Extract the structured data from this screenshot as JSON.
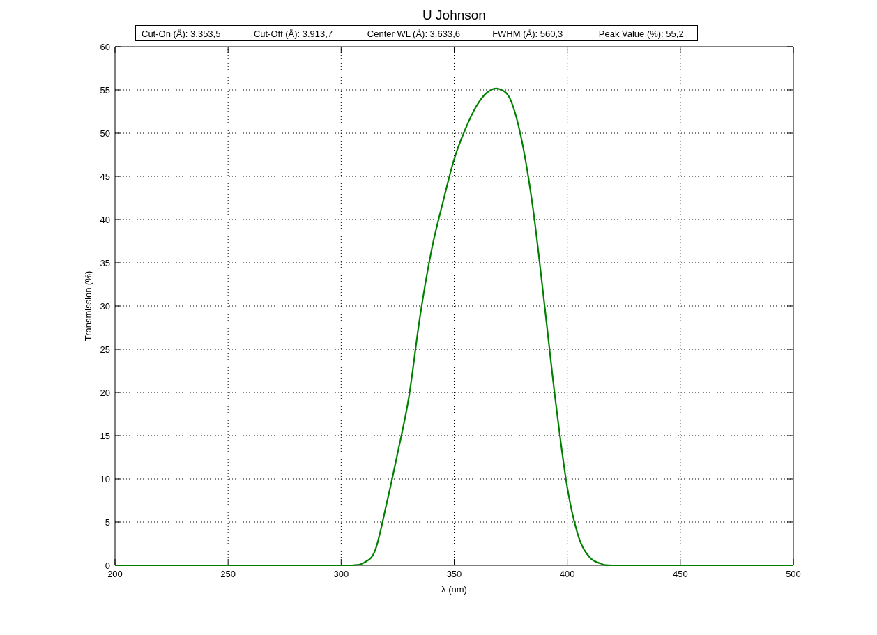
{
  "chart_data": {
    "type": "line",
    "title": "U Johnson",
    "xlabel": "λ (nm)",
    "ylabel": "Transmission (%)",
    "grid": true,
    "xlim": [
      200,
      500
    ],
    "ylim": [
      0,
      60
    ],
    "xticks": [
      200,
      250,
      300,
      350,
      400,
      450,
      500
    ],
    "yticks": [
      0,
      5,
      10,
      15,
      20,
      25,
      30,
      35,
      40,
      45,
      50,
      55,
      60
    ],
    "x": [
      200,
      250,
      300,
      305,
      310,
      315,
      320,
      325,
      330,
      335,
      340,
      345,
      350,
      355,
      360,
      365,
      370,
      375,
      380,
      385,
      390,
      395,
      400,
      405,
      410,
      415,
      420,
      450,
      500
    ],
    "series": [
      {
        "color": "#008000",
        "values": [
          0,
          0,
          0,
          0,
          0.3,
          1.7,
          7,
          13,
          19.5,
          29,
          36.5,
          42,
          47,
          50.5,
          53.2,
          54.8,
          55.1,
          53.8,
          49,
          41,
          30,
          18.6,
          9,
          3.3,
          0.9,
          0.2,
          0,
          0,
          0
        ]
      }
    ],
    "annotations": [
      "Cut-On (Å): 3.353,5",
      "Cut-Off (Å): 3.913,7",
      "Center WL (Å): 3.633,6",
      "FWHM (Å): 560,3",
      "Peak Value (%): 55,2"
    ]
  }
}
